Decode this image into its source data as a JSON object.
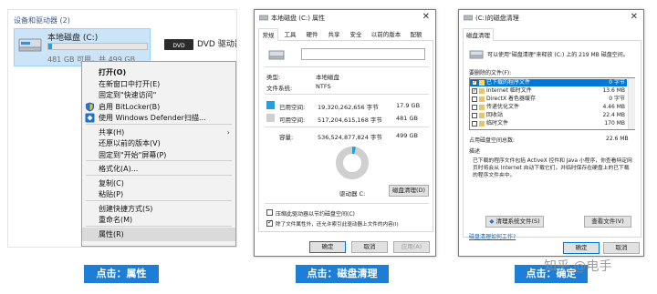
{
  "explorer": {
    "section_header": "设备和驱动器 (2)",
    "drive_c": {
      "name": "本地磁盘 (C:)",
      "free_text": "481 GB 可用，共 499 GB",
      "usage_fraction": 0.036
    },
    "dvd_drive": {
      "name": "DVD 驱动器 ("
    },
    "context_menu": [
      {
        "label": "打开(O)",
        "bold": true,
        "icon": ""
      },
      {
        "label": "在新窗口中打开(E)",
        "icon": ""
      },
      {
        "label": "固定到\"快速访问\"",
        "icon": ""
      },
      {
        "label": "启用 BitLocker(B)",
        "icon": "shield-icon"
      },
      {
        "label": "使用 Windows Defender扫描...",
        "icon": "defender-icon"
      },
      {
        "separator": true
      },
      {
        "label": "共享(H)",
        "submenu": true,
        "icon": ""
      },
      {
        "label": "还原以前的版本(V)",
        "icon": ""
      },
      {
        "label": "固定到\"开始\"屏幕(P)",
        "icon": ""
      },
      {
        "separator": true
      },
      {
        "label": "格式化(A)...",
        "icon": ""
      },
      {
        "separator": true
      },
      {
        "label": "复制(C)",
        "icon": ""
      },
      {
        "label": "粘贴(P)",
        "icon": ""
      },
      {
        "separator": true
      },
      {
        "label": "创建快捷方式(S)",
        "icon": ""
      },
      {
        "label": "重命名(M)",
        "icon": ""
      },
      {
        "separator": true
      },
      {
        "label": "属性(R)",
        "highlight": true,
        "icon": ""
      }
    ],
    "caption": "点击：属性"
  },
  "properties": {
    "title": "本地磁盘 (C:) 属性",
    "tabs": [
      "常规",
      "工具",
      "硬件",
      "共享",
      "安全",
      "以前的版本",
      "配额"
    ],
    "type_label": "类型:",
    "type_value": "本地磁盘",
    "fs_label": "文件系统:",
    "fs_value": "NTFS",
    "used_label": "已用空间:",
    "used_bytes": "19,320,262,656 字节",
    "used_gb": "17.9 GB",
    "free_label": "可用空间:",
    "free_bytes": "517,204,615,168 字节",
    "free_gb": "481 GB",
    "capacity_label": "容量:",
    "capacity_bytes": "536,524,877,824 字节",
    "capacity_gb": "499 GB",
    "drive_label": "驱动器 C:",
    "cleanup_button": "磁盘清理(D)",
    "compress_option": "压缩此驱动器以节约磁盘空间(C)",
    "index_option": "除了文件属性外，还允许索引此驱动器上文件的内容(I)",
    "ok": "确定",
    "cancel": "取消",
    "apply": "应用(A)",
    "used_fraction": 0.036,
    "colors": {
      "used": "#26a0da",
      "free": "#cfcfcf"
    },
    "caption": "点击：磁盘清理"
  },
  "cleanup": {
    "title": "(C:)的磁盘清理",
    "tab": "磁盘清理",
    "intro": "可以使用\"磁盘清理\"来释放 (C:) 上的 219 MB 磁盘空间。",
    "delete_label": "要删除的文件(F):",
    "files": [
      {
        "name": "已下载的程序文件",
        "size": "0 字节",
        "checked": true,
        "selected": true
      },
      {
        "name": "Internet 临时文件",
        "size": "13.6 MB",
        "checked": true
      },
      {
        "name": "DirectX 着色器缓存",
        "size": "0 字节",
        "checked": false
      },
      {
        "name": "传递优化文件",
        "size": "4.46 MB",
        "checked": false
      },
      {
        "name": "回收站",
        "size": "22.4 MB",
        "checked": false
      },
      {
        "name": "临时文件",
        "size": "170 MB",
        "checked": false
      }
    ],
    "total_label": "占用磁盘空间总数:",
    "total_value": "22.6 MB",
    "desc_label": "描述",
    "description": "已下载的程序文件包括 ActiveX 控件和 Java 小程序，你查看特定网页时将会从 Internet 自动下载它们，并临时保存在硬盘上的已下载的程序文件夹中。",
    "clean_system_button": "清理系统文件(S)",
    "view_files_button": "查看文件(V)",
    "link": "磁盘清理如何工作?",
    "ok": "确定",
    "cancel": "取消",
    "caption": "点击：确定"
  },
  "watermark": "知乎 @电手"
}
